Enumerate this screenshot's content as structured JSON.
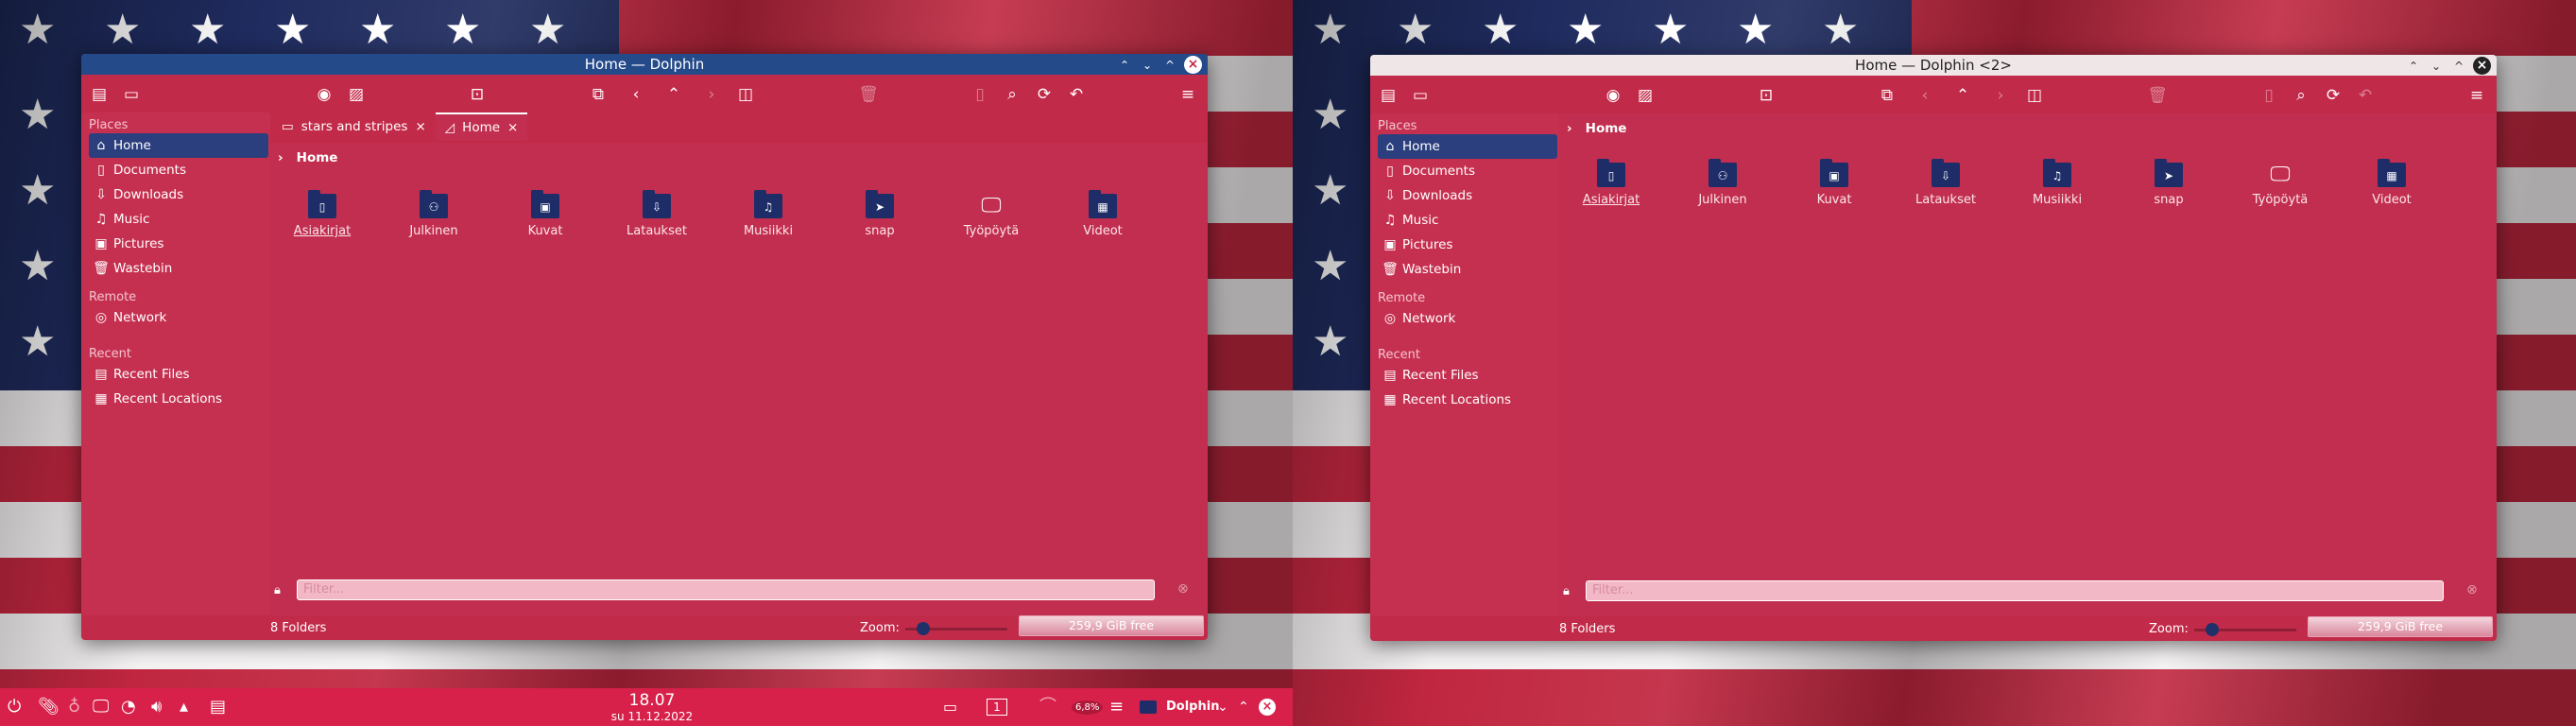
{
  "windows": [
    {
      "title": "Home — Dolphin",
      "places_header": "Places",
      "remote_header": "Remote",
      "recent_header": "Recent",
      "places": [
        "Home",
        "Documents",
        "Downloads",
        "Music",
        "Pictures",
        "Wastebin"
      ],
      "remote": [
        "Network"
      ],
      "recent": [
        "Recent Files",
        "Recent Locations"
      ],
      "tabs": [
        "stars and stripes",
        "Home"
      ],
      "breadcrumb": "Home",
      "folders": [
        "Asiakirjat",
        "Julkinen",
        "Kuvat",
        "Lataukset",
        "Musiikki",
        "snap",
        "Työpöytä",
        "Videot"
      ],
      "filter_placeholder": "Filter...",
      "status": "8 Folders",
      "zoom_label": "Zoom:",
      "free_space": "259,9 GiB free"
    },
    {
      "title": "Home — Dolphin <2>",
      "places_header": "Places",
      "remote_header": "Remote",
      "recent_header": "Recent",
      "places": [
        "Home",
        "Documents",
        "Downloads",
        "Music",
        "Pictures",
        "Wastebin"
      ],
      "remote": [
        "Network"
      ],
      "recent": [
        "Recent Files",
        "Recent Locations"
      ],
      "breadcrumb": "Home",
      "folders": [
        "Asiakirjat",
        "Julkinen",
        "Kuvat",
        "Lataukset",
        "Musiikki",
        "snap",
        "Työpöytä",
        "Videot"
      ],
      "filter_placeholder": "Filter...",
      "status": "8 Folders",
      "zoom_label": "Zoom:",
      "free_space": "259,9 GiB free"
    }
  ],
  "taskbar": {
    "time": "18.07",
    "date": "su 11.12.2022",
    "desktop_number": "1",
    "cpu": "6,8%",
    "task_label": "Dolphin"
  },
  "colors": {
    "window_bg": "#c22a49",
    "selection": "#2b3f7e",
    "taskbar": "#d7214a"
  },
  "zoom_level": 0.3
}
